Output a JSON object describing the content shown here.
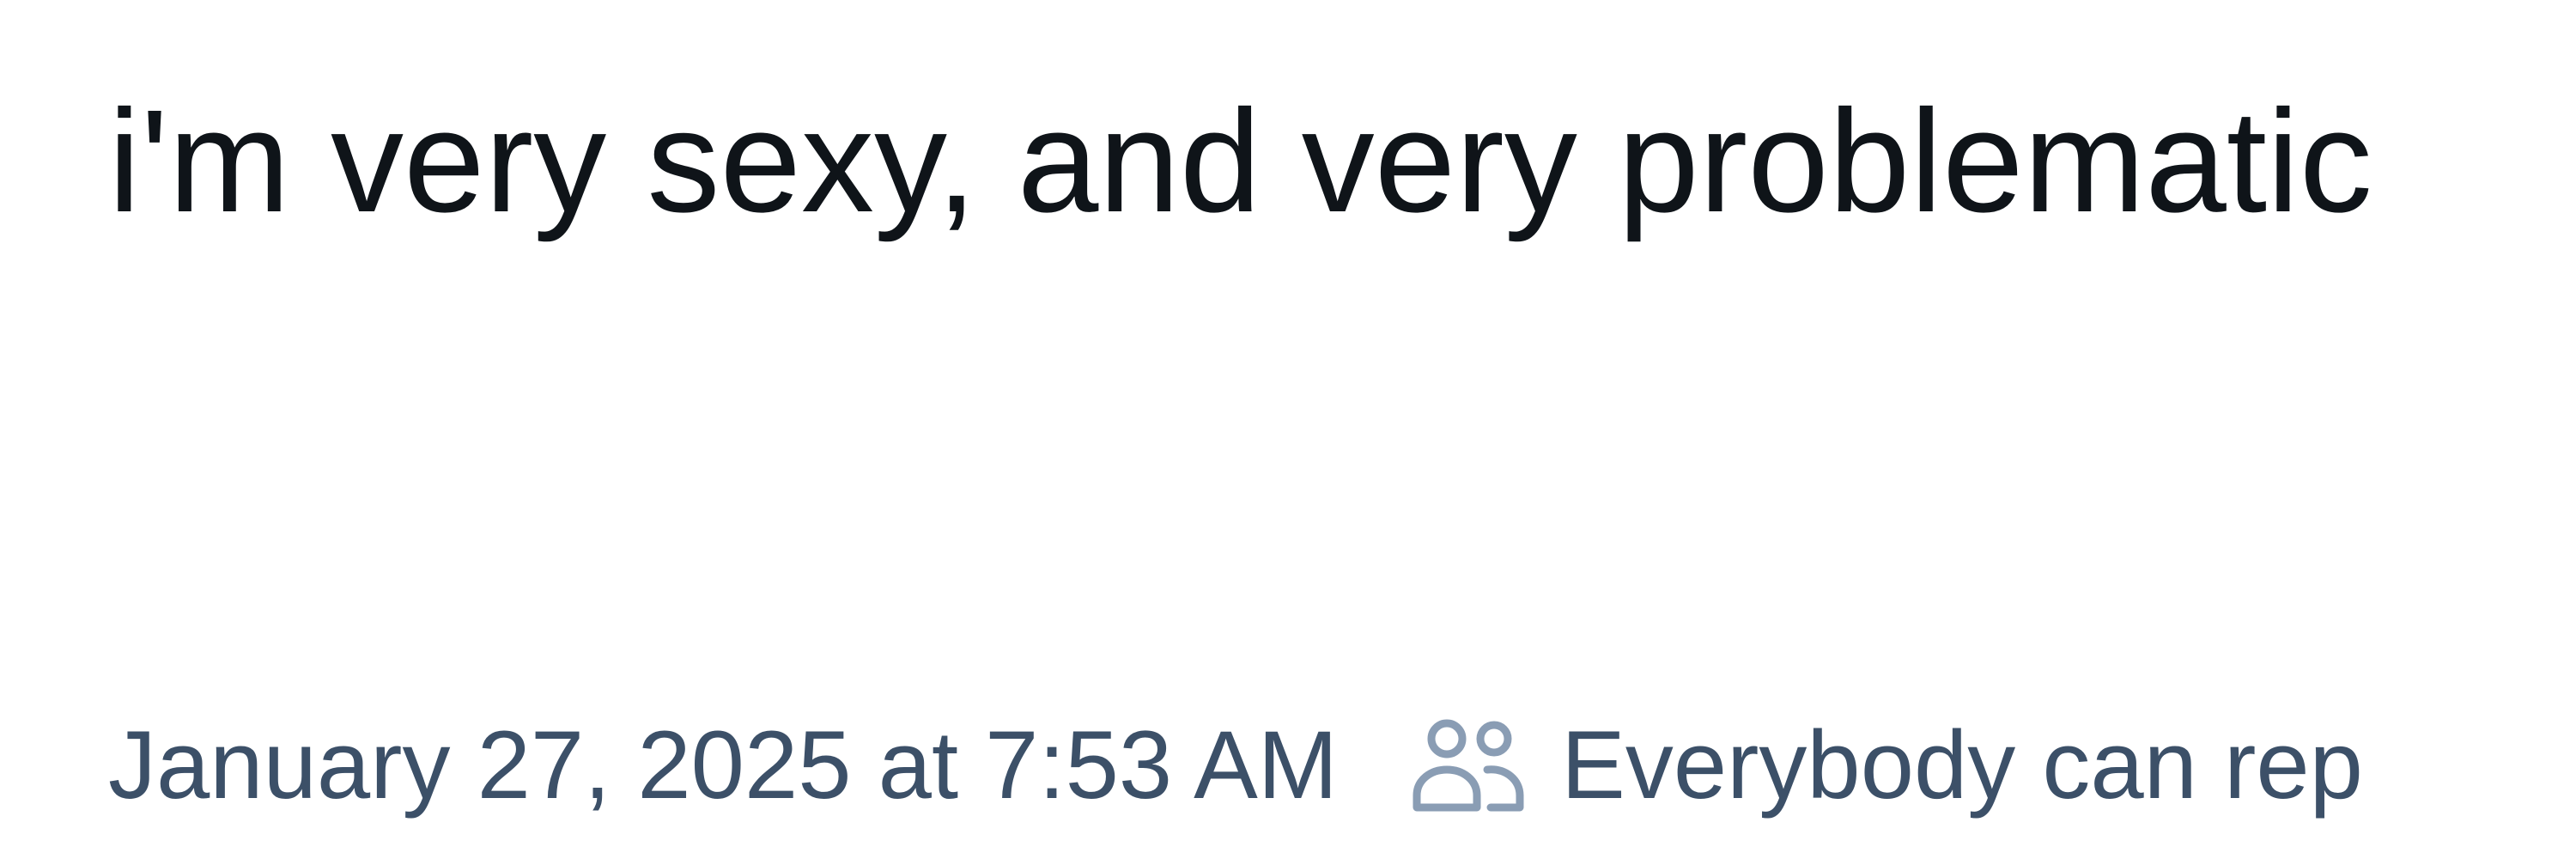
{
  "post": {
    "text": "i'm very sexy, and very problematic"
  },
  "meta": {
    "timestamp": "January 27, 2025 at 7:53 AM",
    "reply_icon": "people-icon",
    "reply_setting": "Everybody can rep",
    "text_color": "#3c5068",
    "icon_color": "#8a9db4"
  }
}
